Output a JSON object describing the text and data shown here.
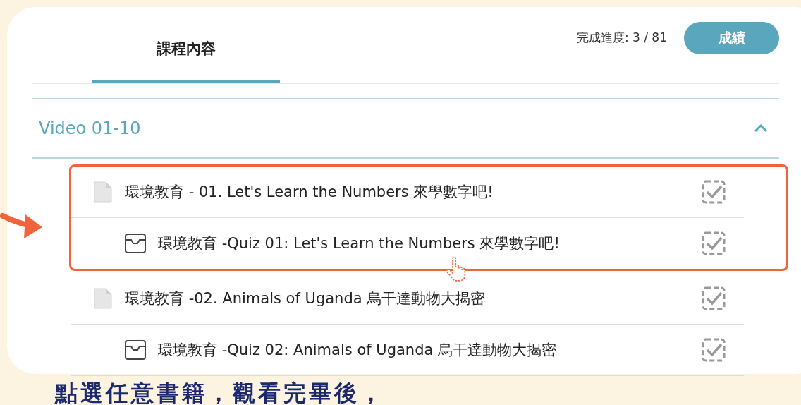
{
  "tabs": [
    {
      "label": "課程內容",
      "selected": true
    }
  ],
  "progress": {
    "label": "完成進度: 3 / 81"
  },
  "grade_button": {
    "label": "成績"
  },
  "section": {
    "title": "Video 01-10",
    "expanded": true,
    "items": [
      {
        "kind": "lesson",
        "title": "環境教育 - 01. Let's Learn the Numbers 來學數字吧!",
        "completed": true,
        "highlighted": true
      },
      {
        "kind": "quiz",
        "title": "環境教育 -Quiz 01: Let's Learn the Numbers 來學數字吧!",
        "completed": true,
        "highlighted": true
      },
      {
        "kind": "lesson",
        "title": "環境教育 -02. Animals of Uganda 烏干達動物大揭密",
        "completed": true,
        "highlighted": false
      },
      {
        "kind": "quiz",
        "title": "環境教育 -Quiz 02: Animals of Uganda 烏干達動物大揭密",
        "completed": true,
        "highlighted": false
      }
    ]
  },
  "caption": "點選任意書籍，觀看完畢後，"
}
